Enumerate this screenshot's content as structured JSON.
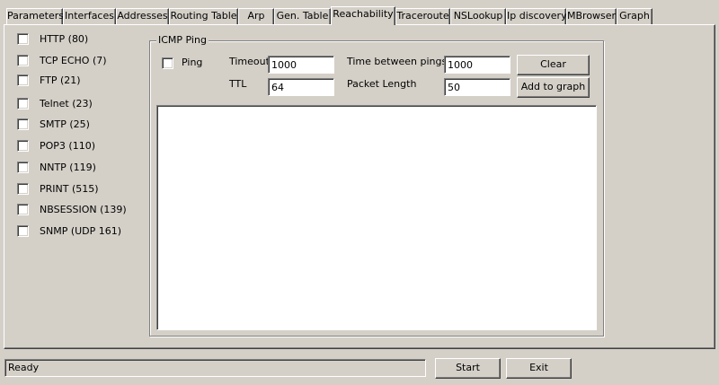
{
  "tabs": [
    {
      "label": "Parameters"
    },
    {
      "label": "Interfaces"
    },
    {
      "label": "Addresses"
    },
    {
      "label": "Routing Table"
    },
    {
      "label": "Arp"
    },
    {
      "label": "Gen. Table"
    },
    {
      "label": "Reachability",
      "active": true
    },
    {
      "label": "Traceroute"
    },
    {
      "label": "NSLookup"
    },
    {
      "label": "Ip discovery"
    },
    {
      "label": "MBrowser"
    },
    {
      "label": "Graph"
    }
  ],
  "services": [
    {
      "label": "HTTP (80)",
      "checked": false
    },
    {
      "label": "TCP ECHO (7)",
      "checked": false
    },
    {
      "label": "FTP (21)",
      "checked": false
    },
    {
      "label": "Telnet (23)",
      "checked": false
    },
    {
      "label": "SMTP (25)",
      "checked": false
    },
    {
      "label": "POP3 (110)",
      "checked": false
    },
    {
      "label": "NNTP (119)",
      "checked": false
    },
    {
      "label": "PRINT (515)",
      "checked": false
    },
    {
      "label": "NBSESSION (139)",
      "checked": false
    },
    {
      "label": "SNMP (UDP 161)",
      "checked": false
    }
  ],
  "icmp": {
    "group_title": "ICMP Ping",
    "ping_label": "Ping",
    "ping_checked": false,
    "timeout_label": "Timeout",
    "timeout_value": "1000",
    "ttl_label": "TTL",
    "ttl_value": "64",
    "time_between_label": "Time between pings",
    "time_between_value": "1000",
    "packet_length_label": "Packet Length",
    "packet_length_value": "50",
    "clear_label": "Clear",
    "add_graph_label": "Add to graph"
  },
  "status": {
    "text": "Ready"
  },
  "footer": {
    "start_label": "Start",
    "exit_label": "Exit"
  }
}
